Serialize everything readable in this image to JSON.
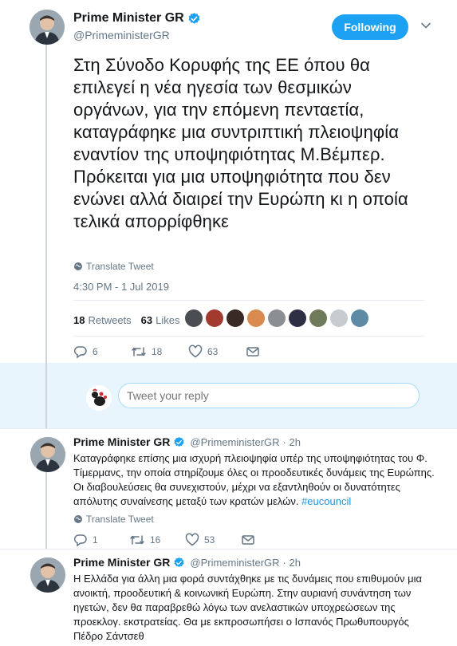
{
  "main_tweet": {
    "author_name": "Prime Minister GR",
    "handle": "@PrimeministerGR",
    "follow_label": "Following",
    "text": "Στη Σύνοδο Κορυφής της ΕΕ όπου θα επιλεγεί η νέα ηγεσία των θεσμικών οργάνων, για την επόμενη πενταετία, καταγράφηκε μια συντριπτική πλειοψηφία εναντίον της υποψηφιότητας Μ.Βέμπερ. Πρόκειται για μια υποψηφιότητα που δεν ενώνει αλλά διαιρεί την Ευρώπη κι η οποία τελικά απορρίφθηκε",
    "translate_label": "Translate Tweet",
    "timestamp": "4:30 PM - 1 Jul 2019",
    "retweets_count": "18",
    "retweets_label": "Retweets",
    "likes_count": "63",
    "likes_label": "Likes",
    "actions": {
      "replies": "6",
      "retweets": "18",
      "likes": "63"
    }
  },
  "reply_box": {
    "placeholder": "Tweet your reply"
  },
  "replies": [
    {
      "author_name": "Prime Minister GR",
      "handle": "@PrimeministerGR",
      "time": "· 2h",
      "text": "Καταγράφηκε επίσης μια ισχυρή πλειοψηφία υπέρ της υποψηφιότητας του Φ. Τίμερμανς, την οποία στηρίζουμε όλες οι προοδευτικές δυνάμεις της Ευρώπης. Οι διαβουλεύσεις θα συνεχιστούν, μέχρι να εξαντληθούν οι δυνατότητες απόλυτης συναίνεσης μεταξύ των κρατών μελών.",
      "hashtag": "#eucouncil",
      "translate_label": "Translate Tweet",
      "actions": {
        "replies": "1",
        "retweets": "16",
        "likes": "53"
      }
    },
    {
      "author_name": "Prime Minister GR",
      "handle": "@PrimeministerGR",
      "time": "· 2h",
      "text": "Η Ελλάδα για άλλη μια φορά συντάχθηκε με τις δυνάμεις που επιθυμούν μια ανοικτή, προοδευτική & κοινωνική Ευρώπη. Στην αυριανή συνάντηση των ηγετών, δεν θα παραβρεθώ λόγω των ανελαστικών υποχρεώσεων της προεκλογ. εκστρατείας. Θα με εκπροσωπήσει ο Ισπανός Πρωθυπουργός Πέδρο Σάντσεθ"
    }
  ],
  "colors": {
    "accent": "#1da1f2",
    "reply_bar_bg": "#e8f5fd",
    "secondary_text": "#657786",
    "hashtag": "#1b95e0"
  }
}
